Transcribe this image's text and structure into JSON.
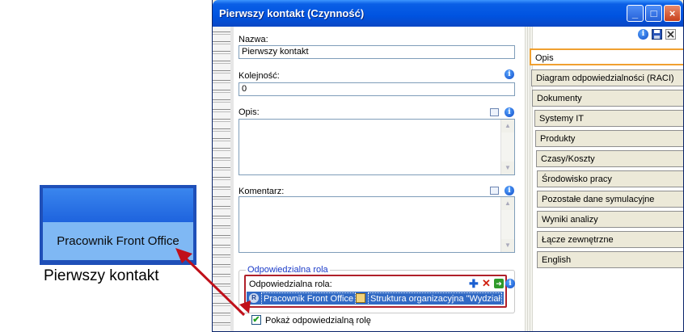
{
  "diagram": {
    "shape_label": "Pracownik Front Office",
    "caption": "Pierwszy kontakt"
  },
  "window": {
    "title": "Pierwszy kontakt  (Czynność)",
    "controls": {
      "minimize": "_",
      "maximize": "□",
      "close": "×"
    }
  },
  "form": {
    "name_label": "Nazwa:",
    "name_value": "Pierwszy kontakt",
    "order_label": "Kolejność:",
    "order_value": "0",
    "description_label": "Opis:",
    "comment_label": "Komentarz:",
    "role_group_title": "Odpowiedzialna rola",
    "role_label": "Odpowiedzialna rola:",
    "role_badge": "R",
    "role_name": "Pracownik Front Office",
    "org_name": "Struktura organizacyjna \"Wydział",
    "show_role_label": "Pokaż odpowiedzialną rolę",
    "show_role_checked": true
  },
  "icons": {
    "info": "i",
    "scroll_up": "▲",
    "scroll_down": "▼",
    "add": "✚",
    "delete": "✕",
    "go": "➜",
    "check": "✔"
  },
  "tabs": [
    {
      "label": "Opis",
      "active": true
    },
    {
      "label": "Diagram odpowiedzialności (RACI)",
      "active": false
    },
    {
      "label": "Dokumenty",
      "active": false
    },
    {
      "label": "Systemy IT",
      "active": false
    },
    {
      "label": "Produkty",
      "active": false
    },
    {
      "label": "Czasy/Koszty",
      "active": false
    },
    {
      "label": "Środowisko pracy",
      "active": false
    },
    {
      "label": "Pozostałe dane symulacyjne",
      "active": false
    },
    {
      "label": "Wyniki analizy",
      "active": false
    },
    {
      "label": "Łącze zewnętrzne",
      "active": false
    },
    {
      "label": "English",
      "active": false
    }
  ],
  "colors": {
    "accent_red": "#b0202a",
    "selection_blue": "#316ac5",
    "titlebar_blue": "#0053e0",
    "active_tab_border": "#f0a030"
  }
}
